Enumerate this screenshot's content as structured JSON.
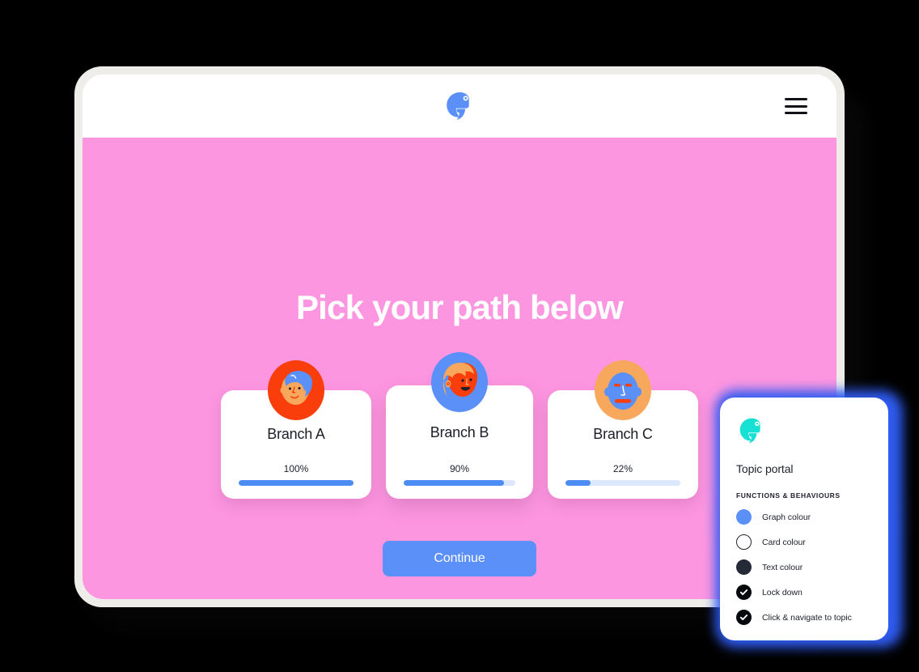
{
  "header": {
    "logo_icon": "chameleon-logo-icon",
    "logo_color": "#5a90f7",
    "menu_icon": "hamburger-menu-icon"
  },
  "main": {
    "title": "Pick your path below",
    "background_color": "#fd96e1",
    "title_color": "#ffffff",
    "continue_label": "Continue",
    "continue_color": "#5a90f7",
    "branches": [
      {
        "name": "Branch A",
        "progress_label": "100%",
        "progress_value": 100,
        "avatar_icon": "avatar-face-a",
        "avatar_bg": "#f93e0c",
        "avatar_skin": "#f8a85c",
        "avatar_hair": "#5a90f7"
      },
      {
        "name": "Branch B",
        "progress_label": "90%",
        "progress_value": 90,
        "avatar_icon": "avatar-face-b",
        "avatar_bg": "#5a90f7",
        "avatar_skin": "#f93e0c",
        "avatar_hair": "#f8a85c"
      },
      {
        "name": "Branch C",
        "progress_label": "22%",
        "progress_value": 22,
        "avatar_icon": "avatar-face-c",
        "avatar_bg": "#f8a85c",
        "avatar_skin": "#5a90f7",
        "avatar_hair": "#f93e0c"
      }
    ],
    "progress_fill_color": "#4d8cf5",
    "progress_track_color": "#dbe8fd"
  },
  "side_panel": {
    "logo_icon": "chameleon-logo-icon",
    "logo_color": "#17e0d4",
    "title": "Topic portal",
    "section_title": "FUNCTIONS & BEHAVIOURS",
    "glow_color": "#2e5bf0",
    "rows": [
      {
        "label": "Graph colour",
        "swatch_type": "graph",
        "swatch_icon": "color-swatch-blue-icon",
        "color": "#5a90f7"
      },
      {
        "label": "Card colour",
        "swatch_type": "card",
        "swatch_icon": "color-swatch-white-icon",
        "color": "#ffffff"
      },
      {
        "label": "Text colour",
        "swatch_type": "text",
        "swatch_icon": "color-swatch-dark-icon",
        "color": "#242a36"
      },
      {
        "label": "Lock down",
        "swatch_type": "check",
        "swatch_icon": "check-circle-icon",
        "color": "#06080c"
      },
      {
        "label": "Click & navigate to topic",
        "swatch_type": "check",
        "swatch_icon": "check-circle-icon",
        "color": "#06080c"
      }
    ]
  }
}
